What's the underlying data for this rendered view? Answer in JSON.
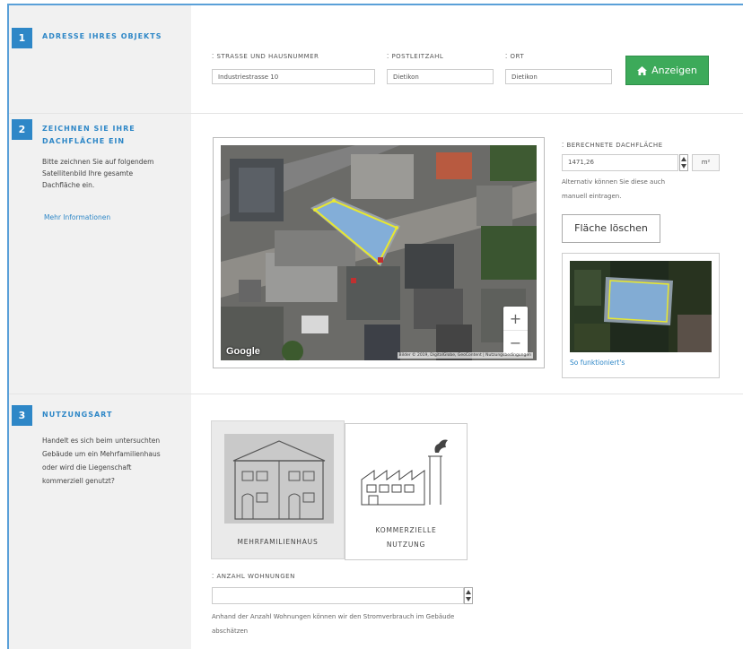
{
  "step1": {
    "number": "1",
    "title": "ADRESSE IHRES OBJEKTS",
    "street_label": "STRASSE UND HAUSNUMMER",
    "street_value": "Industriestrasse 10",
    "zip_label": "POSTLEITZAHL",
    "zip_value": "Dietikon",
    "city_label": "ORT",
    "city_value": "Dietikon",
    "show_button": "Anzeigen",
    "show_icon": "home-icon"
  },
  "step2": {
    "number": "2",
    "title_line1": "ZEICHNEN SIE IHRE",
    "title_line2": "DACHFLÄCHE EIN",
    "desc_line1": "Bitte zeichnen Sie auf folgendem",
    "desc_line2": "Satellitenbild Ihre gesamte",
    "desc_line3": "Dachfläche ein.",
    "more_link": "Mehr Informationen",
    "map_logo": "Google",
    "map_attribution": "Bilder © 2019, DigitalGlobe, GeoContent | Nutzungsbedingungen",
    "zoom_in": "+",
    "zoom_out": "−",
    "area_label": "BERECHNETE DACHFLÄCHE",
    "area_value": "1471,26",
    "area_unit": "m²",
    "area_note_line1": "Alternativ können Sie diese auch",
    "area_note_line2": "manuell eintragen.",
    "clear_button": "Fläche löschen",
    "howto_link": "So funktioniert's"
  },
  "step3": {
    "number": "3",
    "title": "NUTZUNGSART",
    "desc_line1": "Handelt es sich beim untersuchten",
    "desc_line2": "Gebäude um ein Mehrfamilienhaus",
    "desc_line3": "oder wird die Liegenschaft",
    "desc_line4": "kommerziell genutzt?",
    "option1": "MEHRFAMILIENHAUS",
    "option2_line1": "KOMMERZIELLE",
    "option2_line2": "NUTZUNG",
    "apartments_label": "ANZAHL WOHNUNGEN",
    "apartments_value": "",
    "apartments_note_line1": "Anhand der Anzahl Wohnungen können wir den Stromverbrauch im Gebäude",
    "apartments_note_line2": "abschätzen"
  },
  "colors": {
    "accent": "#2e87c7",
    "button_green": "#3daa5a",
    "polygon_fill": "#7fb0e0",
    "polygon_stroke": "#e8e830"
  }
}
